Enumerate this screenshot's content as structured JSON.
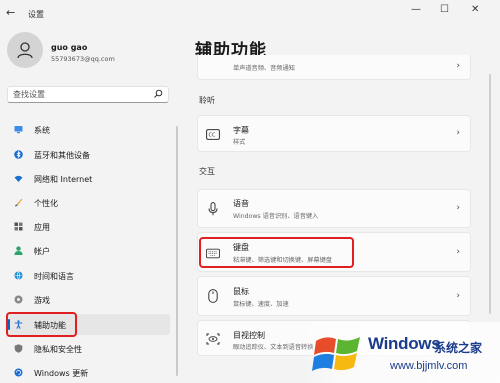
{
  "window": {
    "title": "设置",
    "back_glyph": "←",
    "minimize_glyph": "—",
    "maximize_glyph": "☐",
    "close_glyph": "✕"
  },
  "profile": {
    "name": "guo gao",
    "email": "55793673@qq.com"
  },
  "search": {
    "placeholder": "查找设置"
  },
  "sidebar": {
    "items": [
      {
        "label": "系统",
        "icon": "monitor-icon"
      },
      {
        "label": "蓝牙和其他设备",
        "icon": "bluetooth-icon"
      },
      {
        "label": "网络和 Internet",
        "icon": "wifi-icon"
      },
      {
        "label": "个性化",
        "icon": "brush-icon"
      },
      {
        "label": "应用",
        "icon": "apps-icon"
      },
      {
        "label": "帐户",
        "icon": "account-icon"
      },
      {
        "label": "时间和语言",
        "icon": "globe-icon"
      },
      {
        "label": "游戏",
        "icon": "gamepad-icon"
      },
      {
        "label": "辅助功能",
        "icon": "accessibility-icon",
        "active": true
      },
      {
        "label": "隐私和安全性",
        "icon": "shield-icon"
      },
      {
        "label": "Windows 更新",
        "icon": "update-icon"
      }
    ]
  },
  "main": {
    "title": "辅助功能",
    "partial_card": {
      "desc": "单声道音频、音频通知"
    },
    "sections": {
      "hearing": "聆听",
      "interaction": "交互"
    },
    "cards": {
      "captions": {
        "title": "字幕",
        "desc": "样式"
      },
      "speech": {
        "title": "语音",
        "desc": "Windows 语音识别、语音键入"
      },
      "keyboard": {
        "title": "键盘",
        "desc": "粘滞键、筛选键和切换键、屏幕键盘"
      },
      "mouse": {
        "title": "鼠标",
        "desc": "鼠标键、速度、加速"
      },
      "eye": {
        "title": "目视控制",
        "desc": "眼动追踪仪、文本到语音转换"
      }
    },
    "chevron": "›"
  },
  "watermark": {
    "brand": "Windows",
    "cn": "系统之家",
    "url": "www.bjjmlv.com"
  },
  "colors": {
    "accent": "#0067c0",
    "highlight": "#e02020",
    "watermark": "#1a3c8c"
  }
}
